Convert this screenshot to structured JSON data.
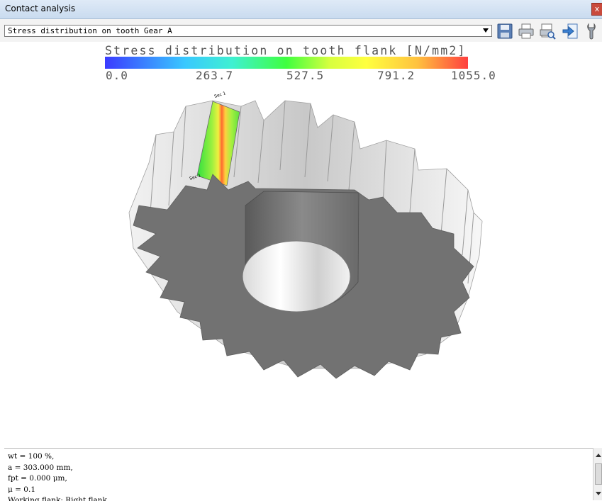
{
  "window": {
    "title": "Contact analysis",
    "close_label": "x"
  },
  "selector": {
    "value": "Stress distribution on tooth Gear A"
  },
  "toolbar": {
    "icons": [
      "save-icon",
      "print-icon",
      "print-preview-icon",
      "export-icon",
      "settings-wrench-icon"
    ]
  },
  "legend": {
    "title": "Stress distribution on tooth flank [N/mm2]",
    "ticks": [
      "0.0",
      "263.7",
      "527.5",
      "791.2",
      "1055.0"
    ]
  },
  "flank_labels": {
    "top": "Sec 1",
    "bottom": "Sec 1"
  },
  "info_lines": [
    "wt = 100 %,",
    "a = 303.000 mm,",
    "fpt = 0.000 μm,",
    "μ = 0.1",
    "Working flank: Right flank"
  ],
  "colors": {
    "gear_face": "#727272",
    "gear_side": "#d9d9d9",
    "bore": "#e8e8e8",
    "accent_red": "#c94a3c"
  }
}
